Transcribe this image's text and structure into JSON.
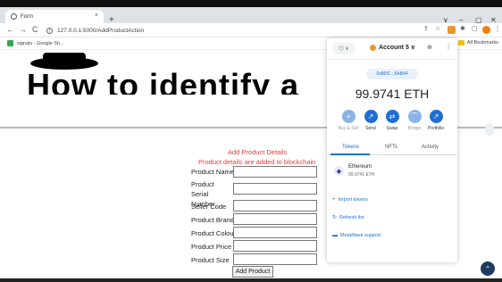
{
  "browser": {
    "tab_title": "Form",
    "tab_close": "×",
    "new_tab": "+",
    "url": "127.0.0.1:5000/AddProductAction",
    "bookmark_1": "signals - Google Sh...",
    "bookmark_all": "All Bookmarks",
    "win_min": "–",
    "win_max": "▢",
    "win_close": "✕",
    "tabs_menu": "∨"
  },
  "page": {
    "heading": "How to identify a",
    "form_title": "Add Product Details",
    "form_subtitle": "Product details are added to blockchain",
    "fields": [
      {
        "label": "Product Name",
        "value": ""
      },
      {
        "label": "Product Serial Number",
        "value": ""
      },
      {
        "label": "Seller Code",
        "value": ""
      },
      {
        "label": "Product Brand",
        "value": ""
      },
      {
        "label": "Product Colour",
        "value": ""
      },
      {
        "label": "Product Price",
        "value": ""
      },
      {
        "label": "Product Size",
        "value": ""
      }
    ],
    "submit_label": "Add Product"
  },
  "metamask": {
    "network_label": "⬡ ∨",
    "account_name": "Account 5 ∨",
    "address": "0x86fC...5AB44",
    "balance": "99.9741 ETH",
    "actions": [
      {
        "label": "Buy & Sell",
        "icon": "+",
        "enabled": false
      },
      {
        "label": "Send",
        "icon": "↗",
        "enabled": true
      },
      {
        "label": "Swap",
        "icon": "⇄",
        "enabled": true
      },
      {
        "label": "Bridge",
        "icon": "⌒",
        "enabled": false
      },
      {
        "label": "Portfolio",
        "icon": "↗",
        "enabled": true
      }
    ],
    "tabs": [
      "Tokens",
      "NFTs",
      "Activity"
    ],
    "token_name": "Ethereum",
    "token_balance": "99.9741 ETH",
    "import_tokens": "Import tokens",
    "refresh_list": "Refresh list",
    "support": "MetaMask support"
  },
  "colors": {
    "accent": "#1f6fd0",
    "form_red": "#e53935"
  }
}
